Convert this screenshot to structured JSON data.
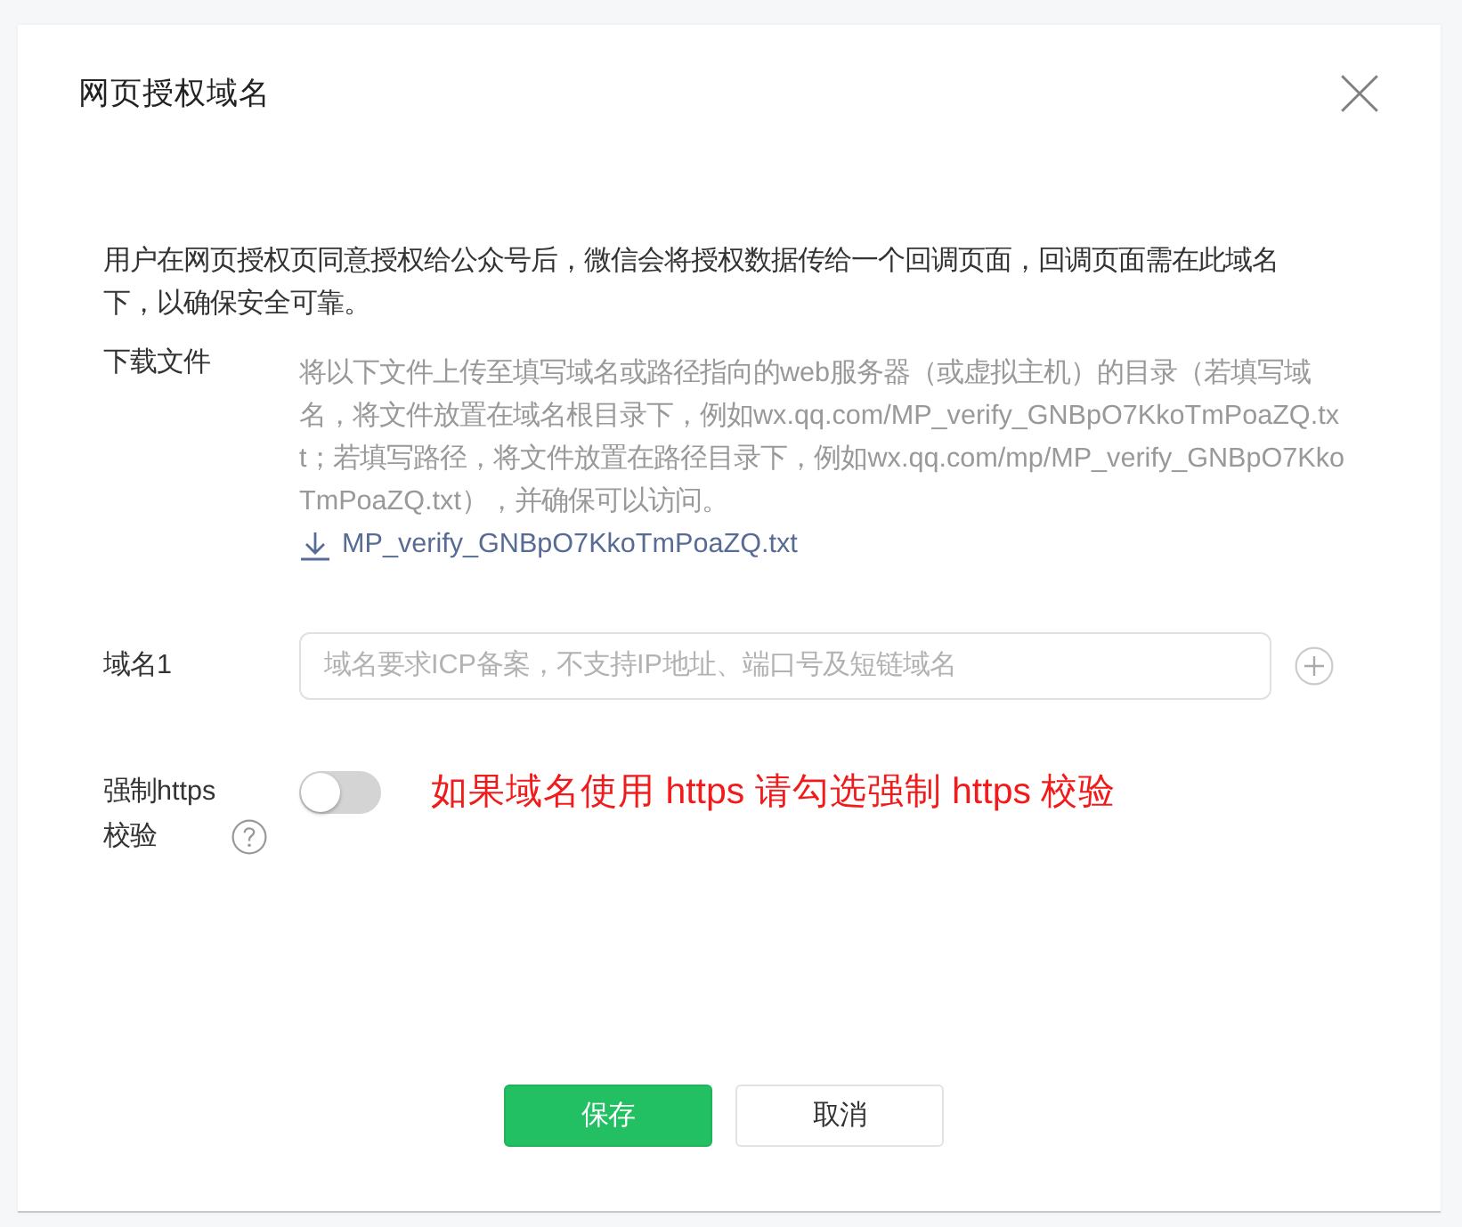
{
  "dialog": {
    "title": "网页授权域名",
    "description": "用户在网页授权页同意授权给公众号后，微信会将授权数据传给一个回调页面，回调页面需在此域名下，以确保安全可靠。"
  },
  "download_file": {
    "label": "下载文件",
    "instructions": "将以下文件上传至填写域名或路径指向的web服务器（或虚拟主机）的目录（若填写域名，将文件放置在域名根目录下，例如wx.qq.com/MP_verify_GNBpO7KkoTmPoaZQ.txt；若填写路径，将文件放置在路径目录下，例如wx.qq.com/mp/MP_verify_GNBpO7KkoTmPoaZQ.txt），并确保可以访问。",
    "link": "MP_verify_GNBpO7KkoTmPoaZQ.txt"
  },
  "domains": [
    {
      "label": "域名1",
      "placeholder": "域名要求ICP备案，不支持IP地址、端口号及短链域名"
    }
  ],
  "force_https": {
    "label": "强制https校验",
    "on": false,
    "note": "如果域名使用 https 请勾选强制 https 校验"
  },
  "buttons": [
    {
      "label": "保存",
      "kind": "primary"
    },
    {
      "label": "取消",
      "kind": "default"
    }
  ]
}
